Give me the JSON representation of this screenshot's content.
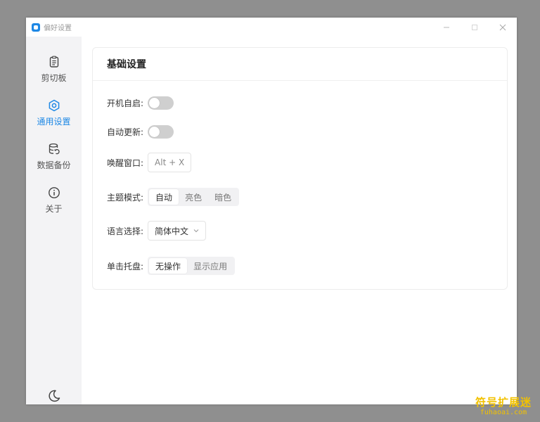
{
  "window": {
    "title": "偏好设置",
    "controls": {
      "minimize": "minimize-icon",
      "maximize": "maximize-icon",
      "close": "close-icon"
    }
  },
  "sidebar": {
    "items": [
      {
        "label": "剪切板",
        "icon": "clipboard-icon",
        "active": false
      },
      {
        "label": "通用设置",
        "icon": "hexagon-settings-icon",
        "active": true
      },
      {
        "label": "数据备份",
        "icon": "database-backup-icon",
        "active": false
      },
      {
        "label": "关于",
        "icon": "info-icon",
        "active": false
      }
    ],
    "theme_toggle_icon": "moon-icon"
  },
  "settings": {
    "section_title": "基础设置",
    "startup": {
      "label": "开机自启:",
      "enabled": false
    },
    "auto_update": {
      "label": "自动更新:",
      "enabled": false
    },
    "wake_window": {
      "label": "唤醒窗口:",
      "value": "Alt + X"
    },
    "theme_mode": {
      "label": "主题模式:",
      "options": [
        "自动",
        "亮色",
        "暗色"
      ],
      "selected": "自动"
    },
    "language": {
      "label": "语言选择:",
      "value": "简体中文"
    },
    "tray_click": {
      "label": "单击托盘:",
      "options": [
        "无操作",
        "显示应用"
      ],
      "selected": "无操作"
    }
  },
  "watermark": {
    "text": "符号扩展迷",
    "url": "fuhaoai.com"
  },
  "colors": {
    "accent": "#1e88e5",
    "sidebar_bg": "#f3f3f5",
    "toggle_off": "#cfcfcf"
  }
}
